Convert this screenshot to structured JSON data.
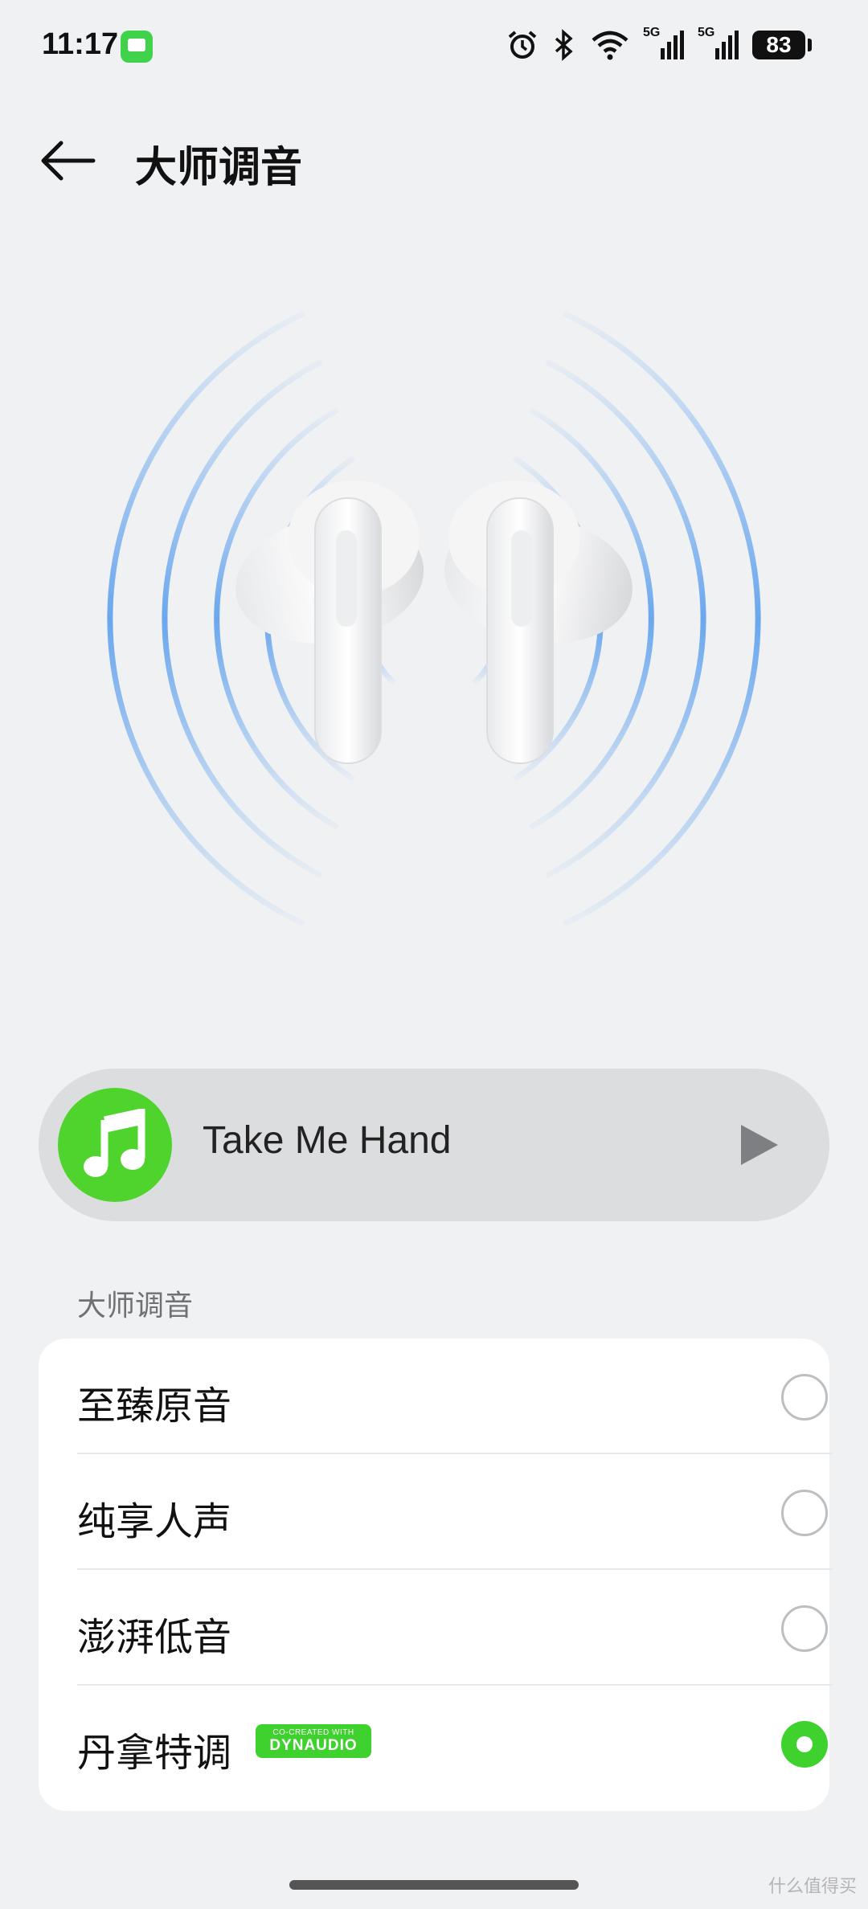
{
  "status_bar": {
    "time": "11:17",
    "network_1": "5G",
    "network_2": "5G",
    "battery": "83"
  },
  "header": {
    "title": "大师调音"
  },
  "player": {
    "song_title": "Take Me Hand"
  },
  "section": {
    "label": "大师调音"
  },
  "options": [
    {
      "label": "至臻原音",
      "selected": false
    },
    {
      "label": "纯享人声",
      "selected": false
    },
    {
      "label": "澎湃低音",
      "selected": false
    },
    {
      "label": "丹拿特调",
      "selected": true,
      "badge_top": "CO-CREATED WITH",
      "badge_bottom": "DYNAUDIO"
    }
  ],
  "watermark": "什么值得买",
  "colors": {
    "accent_green": "#3fd22f",
    "ring_blue": "#6aa7ee",
    "background": "#eff1f3"
  }
}
